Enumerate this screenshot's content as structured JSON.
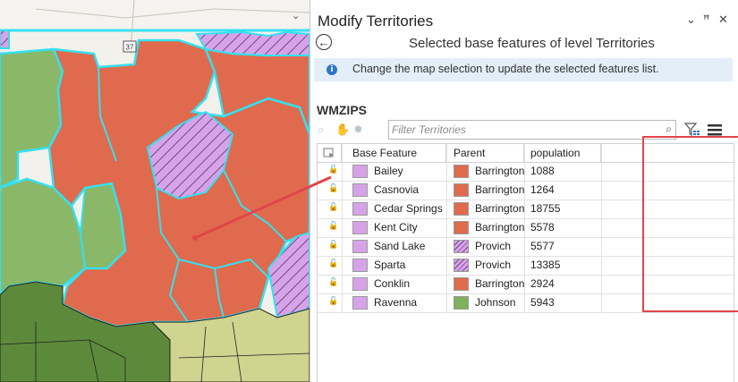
{
  "map": {
    "road_label": "37",
    "collapse_icon": "chevron-down-icon"
  },
  "pane": {
    "title": "Modify Territories",
    "controls": {
      "dropdown_icon": "⌄",
      "pin_icon": "ꟸ",
      "close_icon": "✕"
    },
    "back_icon": "←",
    "subtitle": "Selected base features of level Territories",
    "info": {
      "icon": "i",
      "text": "Change the map selection to update the selected features list."
    },
    "layer_name": "WMZIPS",
    "filter": {
      "placeholder": "Filter Territories",
      "value": ""
    },
    "table": {
      "columns": [
        "Base Feature",
        "Parent",
        "population"
      ],
      "rows": [
        {
          "base_feature": "Bailey",
          "base_color": "#d7a3e8",
          "parent": "Barrington",
          "parent_color": "#e06a4d",
          "parent_pattern": "solid",
          "population": "1088"
        },
        {
          "base_feature": "Casnovia",
          "base_color": "#d7a3e8",
          "parent": "Barrington",
          "parent_color": "#e06a4d",
          "parent_pattern": "solid",
          "population": "1264"
        },
        {
          "base_feature": "Cedar Springs",
          "base_color": "#d7a3e8",
          "parent": "Barrington",
          "parent_color": "#e06a4d",
          "parent_pattern": "solid",
          "population": "18755"
        },
        {
          "base_feature": "Kent City",
          "base_color": "#d7a3e8",
          "parent": "Barrington",
          "parent_color": "#e06a4d",
          "parent_pattern": "solid",
          "population": "5578"
        },
        {
          "base_feature": "Sand Lake",
          "base_color": "#d7a3e8",
          "parent": "Provich",
          "parent_color": "#d7a3e8",
          "parent_pattern": "hatch",
          "population": "5577"
        },
        {
          "base_feature": "Sparta",
          "base_color": "#d7a3e8",
          "parent": "Provich",
          "parent_color": "#d7a3e8",
          "parent_pattern": "hatch",
          "population": "13385"
        },
        {
          "base_feature": "Conklin",
          "base_color": "#d7a3e8",
          "parent": "Barrington",
          "parent_color": "#e06a4d",
          "parent_pattern": "solid",
          "population": "2924"
        },
        {
          "base_feature": "Ravenna",
          "base_color": "#d7a3e8",
          "parent": "Johnson",
          "parent_color": "#7fb05a",
          "parent_pattern": "solid",
          "population": "5943"
        }
      ]
    }
  },
  "colors": {
    "territory_orange": "#e06a4d",
    "territory_green": "#8ab868",
    "territory_darkgreen": "#5c8a3a",
    "territory_yellowgreen": "#cfd48f",
    "territory_purple": "#d7a3e8",
    "outline_cyan": "#35e0f0",
    "callout_red": "#e0464a",
    "info_bg": "#e3eef8"
  }
}
